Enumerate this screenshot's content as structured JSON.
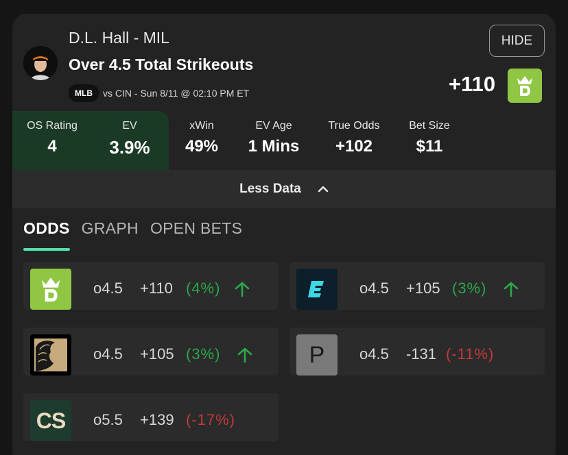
{
  "header": {
    "player": "D.L. Hall - MIL",
    "market": "Over 4.5 Total Strikeouts",
    "league": "MLB",
    "game": "vs CIN - Sun 8/11 @ 02:10 PM ET",
    "hide_label": "HIDE",
    "odds": "+110",
    "book_icon": "draftkings-crown-icon"
  },
  "stats": [
    {
      "label": "OS Rating",
      "value": "4"
    },
    {
      "label": "EV",
      "value": "3.9%"
    },
    {
      "label": "xWin",
      "value": "49%"
    },
    {
      "label": "EV Age",
      "value": "1 Mins"
    },
    {
      "label": "True Odds",
      "value": "+102"
    },
    {
      "label": "Bet Size",
      "value": "$11"
    }
  ],
  "less_data_label": "Less Data",
  "tabs": [
    {
      "label": "ODDS",
      "active": true
    },
    {
      "label": "GRAPH",
      "active": false
    },
    {
      "label": "OPEN BETS",
      "active": false
    }
  ],
  "books": [
    {
      "icon": "draftkings-icon",
      "line": "o4.5",
      "price": "+110",
      "pct": "(4%)",
      "trend": "up",
      "pct_color": "#2ba84a"
    },
    {
      "icon": "espnbet-icon",
      "line": "o4.5",
      "price": "+105",
      "pct": "(3%)",
      "trend": "up",
      "pct_color": "#2ba84a"
    },
    {
      "icon": "betmgm-lion-icon",
      "line": "o4.5",
      "price": "+105",
      "pct": "(3%)",
      "trend": "up",
      "pct_color": "#2ba84a"
    },
    {
      "icon": "p-letter-icon",
      "letter": "P",
      "line": "o4.5",
      "price": "-131",
      "pct": "(-11%)",
      "trend": "none",
      "pct_color": "#c23a3a"
    },
    {
      "icon": "caesars-cs-icon",
      "letter": "CS",
      "line": "o5.5",
      "price": "+139",
      "pct": "(-17%)",
      "trend": "none",
      "pct_color": "#c23a3a"
    }
  ],
  "colors": {
    "accent": "#52e0a6",
    "positive": "#2ba84a",
    "negative": "#c23a3a",
    "draftkings": "#8fc744"
  }
}
